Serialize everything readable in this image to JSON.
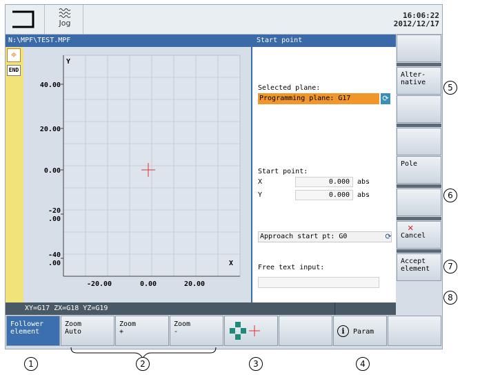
{
  "header": {
    "mode_label": "Jog",
    "clock_time": "16:06:22",
    "clock_date": "2012/12/17"
  },
  "path": "N:\\MPF\\TEST.MPF",
  "panel_title": "Start point",
  "strip": {
    "end_label": "END"
  },
  "graph": {
    "y_label": "Y",
    "x_label": "X",
    "y_ticks": [
      "40.00",
      "20.00",
      "0.00",
      "-20\n.00",
      "-40\n.00"
    ],
    "x_ticks": [
      "-20.00",
      "0.00",
      "20.00"
    ]
  },
  "form": {
    "selected_plane_label": "Selected plane:",
    "selected_plane_value": "Programming plane: G17",
    "start_point_label": "Start point:",
    "x_label": "X",
    "x_value": "0.000",
    "x_unit": "abs",
    "y_label": "Y",
    "y_value": "0.000",
    "y_unit": "abs",
    "approach_value": "Approach start pt: G0",
    "free_text_label": "Free text input:",
    "free_text_value": ""
  },
  "vertical_softkeys": [
    {
      "label": ""
    },
    {
      "label": "Alter-\nnative"
    },
    {
      "label": ""
    },
    {
      "label": ""
    },
    {
      "label": "Pole"
    },
    {
      "label": ""
    },
    {
      "label": "Cancel"
    },
    {
      "label": "Accept\nelement"
    }
  ],
  "status_bar": "XY=G17 ZX=G18 YZ=G19",
  "horizontal_softkeys": [
    {
      "label": "Follower\nelement"
    },
    {
      "label": "Zoom\nAuto"
    },
    {
      "label": "Zoom\n+"
    },
    {
      "label": "Zoom\n-"
    },
    {
      "label": ""
    },
    {
      "label": ""
    },
    {
      "label": "Param"
    },
    {
      "label": ""
    }
  ],
  "callouts": [
    "1",
    "2",
    "3",
    "4",
    "5",
    "6",
    "7",
    "8"
  ],
  "colors": {
    "accent_blue": "#3a6aa7",
    "highlight_orange": "#f0962a",
    "cancel_red": "#e02020"
  }
}
